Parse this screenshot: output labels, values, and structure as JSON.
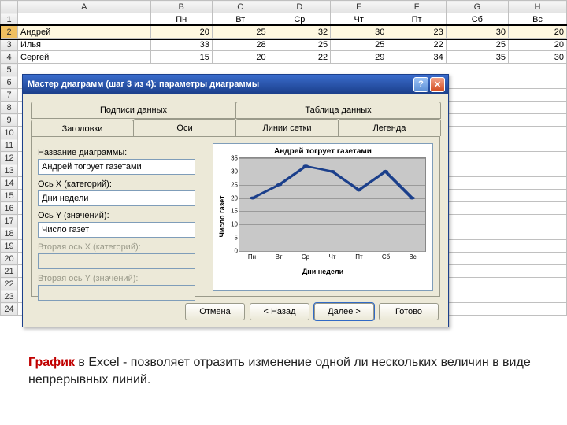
{
  "sheet": {
    "cols": [
      "A",
      "B",
      "C",
      "D",
      "E",
      "F",
      "G",
      "H"
    ],
    "rows": [
      "1",
      "2",
      "3",
      "4",
      "5",
      "6",
      "7",
      "8",
      "9",
      "10",
      "11",
      "12",
      "13",
      "14",
      "15",
      "16",
      "17",
      "18",
      "19",
      "20",
      "21",
      "22",
      "23",
      "24"
    ],
    "header_row": [
      "",
      "Пн",
      "Вт",
      "Ср",
      "Чт",
      "Пт",
      "Сб",
      "Вс"
    ],
    "data": [
      [
        "Андрей",
        "20",
        "25",
        "32",
        "30",
        "23",
        "30",
        "20"
      ],
      [
        "Илья",
        "33",
        "28",
        "25",
        "25",
        "22",
        "25",
        "20"
      ],
      [
        "Сергей",
        "15",
        "20",
        "22",
        "29",
        "34",
        "35",
        "30"
      ]
    ]
  },
  "dialog": {
    "title": "Мастер диаграмм (шаг 3 из 4): параметры диаграммы",
    "help": "?",
    "close": "✕",
    "tabs_top": [
      "Подписи данных",
      "Таблица данных"
    ],
    "tabs_bottom": [
      "Заголовки",
      "Оси",
      "Линии сетки",
      "Легенда"
    ],
    "active_tab": "Заголовки",
    "fields": {
      "chart_title_label": "Название диаграммы:",
      "chart_title_value": "Андрей тогрует газетами",
      "x_label": "Ось X (категорий):",
      "x_value": "Дни недели",
      "y_label": "Ось Y (значений):",
      "y_value": "Число газет",
      "x2_label": "Вторая ось X (категорий):",
      "x2_value": "",
      "y2_label": "Вторая ось Y (значений):",
      "y2_value": ""
    },
    "preview": {
      "title": "Андрей тогрует газетами",
      "ylabel": "Число газет",
      "xlabel": "Дни недели"
    },
    "buttons": {
      "cancel": "Отмена",
      "back": "< Назад",
      "next": "Далее >",
      "finish": "Готово"
    }
  },
  "chart_data": {
    "type": "line",
    "title": "Андрей тогрует газетами",
    "xlabel": "Дни недели",
    "ylabel": "Число газет",
    "categories": [
      "Пн",
      "Вт",
      "Ср",
      "Чт",
      "Пт",
      "Сб",
      "Вс"
    ],
    "values": [
      20,
      25,
      32,
      30,
      23,
      30,
      20
    ],
    "ylim": [
      0,
      35
    ],
    "yticks": [
      0,
      5,
      10,
      15,
      20,
      25,
      30,
      35
    ]
  },
  "caption": {
    "bold": "График",
    "rest": " в Excel  - позволяет отразить изменение одной ли нескольких величин в виде непрерывных линий."
  }
}
